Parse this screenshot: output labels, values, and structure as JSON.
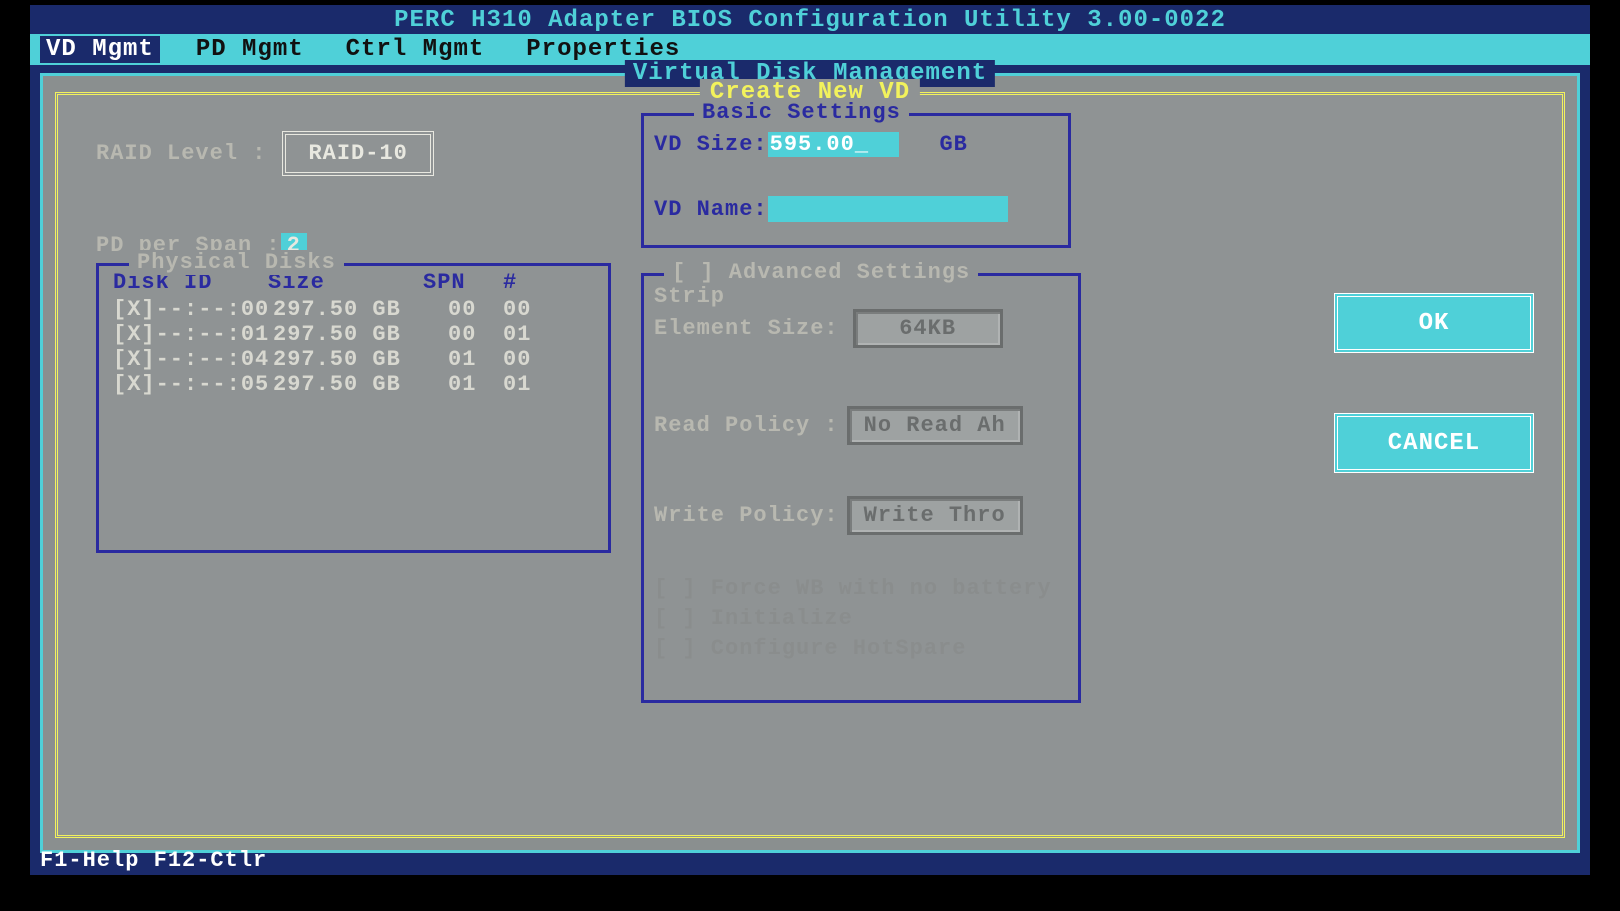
{
  "title": "PERC H310 Adapter BIOS Configuration Utility 3.00-0022",
  "menu": [
    "VD Mgmt",
    "PD Mgmt",
    "Ctrl Mgmt",
    "Properties"
  ],
  "menu_selected": 0,
  "outer_title": "Virtual Disk Management",
  "inner_title": "Create New VD",
  "raid": {
    "label": "RAID Level :",
    "value": "RAID-10"
  },
  "pd_per_span": {
    "label": "PD per Span :",
    "value": "2"
  },
  "physical_disks": {
    "title": "Physical Disks",
    "headers": [
      "Disk ID",
      "Size",
      "SPN",
      "#"
    ],
    "rows": [
      {
        "id": "[X]--:--:00",
        "size": "297.50 GB",
        "spn": "00",
        "num": "00"
      },
      {
        "id": "[X]--:--:01",
        "size": "297.50 GB",
        "spn": "00",
        "num": "01"
      },
      {
        "id": "[X]--:--:04",
        "size": "297.50 GB",
        "spn": "01",
        "num": "00"
      },
      {
        "id": "[X]--:--:05",
        "size": "297.50 GB",
        "spn": "01",
        "num": "01"
      }
    ]
  },
  "basic": {
    "title": "Basic Settings",
    "vd_size_label": "VD Size:",
    "vd_size_value": "595.00",
    "vd_size_unit": "GB",
    "vd_name_label": "VD Name:",
    "vd_name_value": ""
  },
  "advanced": {
    "title": "[ ] Advanced Settings",
    "strip_label1": "Strip",
    "strip_label2": "Element Size:",
    "strip_value": "64KB",
    "read_label": "Read Policy :",
    "read_value": "No Read Ah",
    "write_label": "Write Policy:",
    "write_value": "Write Thro",
    "checks": [
      "[ ] Force WB with no battery",
      "[ ] Initialize",
      "[ ] Configure HotSpare"
    ]
  },
  "buttons": {
    "ok": "OK",
    "cancel": "CANCEL"
  },
  "footer": "F1-Help F12-Ctlr"
}
